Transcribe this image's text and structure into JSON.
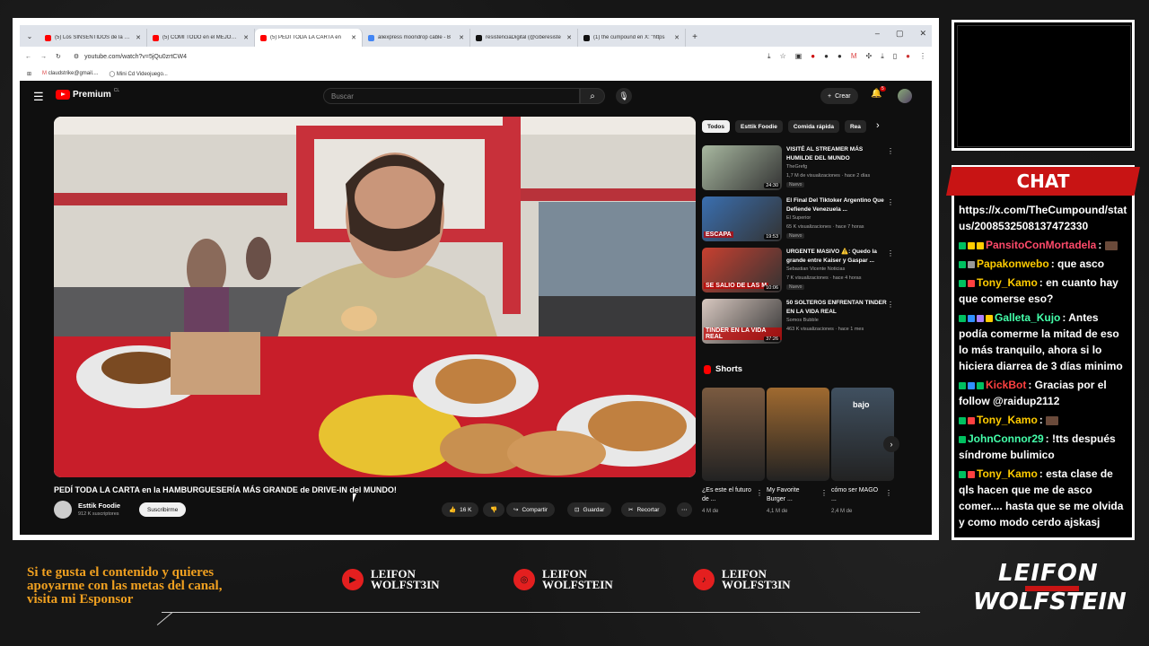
{
  "browser": {
    "tabs": [
      {
        "title": "(5) Los SINSENTIDOS de la saga",
        "favicon_color": "#ff0000"
      },
      {
        "title": "(5) COMÍ TODO en el MEJOR SI",
        "favicon_color": "#ff0000"
      },
      {
        "title": "(5) PEDÍ TODA LA CARTA en",
        "favicon_color": "#ff0000",
        "active": true
      },
      {
        "title": "aliexpress moondrop cable - B",
        "favicon_color": "#4285f4"
      },
      {
        "title": "resistenciaDigital (@ciberesiste",
        "favicon_color": "#111111"
      },
      {
        "title": "(1) the cumpound en X: \"https",
        "favicon_color": "#111111"
      }
    ],
    "new_tab": "+",
    "window_controls": {
      "minimize": "–",
      "maximize": "▢",
      "close": "✕"
    },
    "url": "youtube.com/watch?v=5jQu0zrtCW4",
    "bookmarks": [
      {
        "label": "claudstrike@gmail...."
      },
      {
        "label": "Mini Cd Videojuego..."
      }
    ]
  },
  "youtube": {
    "logo_text": "Premium",
    "logo_country": "CL",
    "search_placeholder": "Buscar",
    "create_label": "Crear",
    "notification_count": "5",
    "video": {
      "title": "PEDÍ TODA LA CARTA en la HAMBURGUESERÍA MÁS GRANDE de DRIVE-IN del MUNDO!",
      "channel": "Esttik Foodie",
      "subscribers": "912 K suscriptores",
      "subscribe_label": "Suscribirme",
      "likes": "16 K",
      "share_label": "Compartir",
      "save_label": "Guardar",
      "clip_label": "Recortar"
    },
    "chips": [
      "Todos",
      "Esttik Foodie",
      "Comida rápida",
      "Rea"
    ],
    "recommendations": [
      {
        "title": "VISITÉ AL STREAMER MÁS HUMILDE DEL MUNDO",
        "channel": "TheGrefg",
        "views": "1,7 M de visualizaciones · hace 2 días",
        "badge": "Nuevo",
        "duration": "24:30",
        "thumb_color": "#a8b8a0"
      },
      {
        "title": "El Final Del Tiktoker Argentino Que Defiende Venezuela ...",
        "channel": "El Superior",
        "views": "65 K visualizaciones · hace 7 horas",
        "badge": "Nuevo",
        "duration": "19:53",
        "thumb_color": "#3a6fb0",
        "thumb_text": "ESCAPA"
      },
      {
        "title": "URGENTE MASIVO ⚠️: Quedo la grande entre Kaiser y Gaspar ...",
        "channel": "Sebastian Vicente Noticias",
        "views": "7 K visualizaciones · hace 4 horas",
        "badge": "Nuevo",
        "duration": "10:06",
        "thumb_color": "#c84030",
        "thumb_text": "SE SALIO DE LAS M"
      },
      {
        "title": "50 SOLTEROS ENFRENTAN TINDER EN LA VIDA REAL",
        "channel": "Somos Bubble",
        "views": "463 K visualizaciones · hace 1 mes",
        "badge": "",
        "duration": "37:26",
        "thumb_color": "#d8c8c0",
        "thumb_text": "TINDER EN LA VIDA REAL"
      }
    ],
    "shorts_heading": "Shorts",
    "shorts": [
      {
        "title": "¿Es este el futuro de ...",
        "views": "4 M de",
        "thumb_color": "#7a5a40"
      },
      {
        "title": "My Favorite Burger ...",
        "views": "4,1 M de",
        "thumb_color": "#a06a30"
      },
      {
        "title": "cómo ser MAGO ...",
        "views": "2,4 M de",
        "thumb_color": "#405060",
        "thumb_text": "bajo"
      }
    ]
  },
  "overlay": {
    "chat_title": "CHAT",
    "chat_messages": [
      {
        "user": "",
        "text": "https://x.com/TheCumpound/status/2008532508137472330",
        "user_color": "#ffffff"
      },
      {
        "user": "PansitoConMortadela",
        "text": ":",
        "user_color": "#ff4a6a",
        "badges": [
          "#00c060",
          "#ffcc00",
          "#ffcc00"
        ],
        "emote_after": true
      },
      {
        "user": "Papakonwebo",
        "text": ": que asco",
        "user_color": "#ffcc00",
        "badges": [
          "#00c060",
          "#999999"
        ]
      },
      {
        "user": "Tony_Kamo",
        "text": ": en cuanto hay que comerse eso?",
        "user_color": "#ffcc00",
        "badges": [
          "#00c060",
          "#ff4040"
        ]
      },
      {
        "user": "Galleta_Kujo",
        "text": ": Antes podía comerme la mitad de eso lo más tranquilo, ahora si lo hiciera diarrea de 3 días minimo",
        "user_color": "#44ffaa",
        "badges": [
          "#00c060",
          "#3090ff",
          "#aa80ff",
          "#ffcc00"
        ]
      },
      {
        "user": "KickBot",
        "text": ": Gracias por el follow @raidup2112",
        "user_color": "#ff4040",
        "badges": [
          "#00c060",
          "#3090ff",
          "#00c060"
        ]
      },
      {
        "user": "Tony_Kamo",
        "text": ":",
        "user_color": "#ffcc00",
        "badges": [
          "#00c060",
          "#ff4040"
        ],
        "emote_after": true
      },
      {
        "user": "JohnConnor29",
        "text": ": !tts después síndrome bulimico",
        "user_color": "#44ffaa",
        "badges": [
          "#00c060"
        ]
      },
      {
        "user": "Tony_Kamo",
        "text": ": esta clase de qls hacen que me de asco comer.... hasta que se me olvida y como modo cerdo ajskasj",
        "user_color": "#ffcc00",
        "badges": [
          "#00c060",
          "#ff4040"
        ]
      }
    ],
    "sponsor_text": [
      "Si te gusta el contenido y quieres",
      "apoyarme con las metas del canal,",
      "visita mi Esponsor"
    ],
    "socials": [
      {
        "platform": "youtube-icon",
        "line1": "LEIFON",
        "line2": "WOLFST3IN",
        "glyph": "▶"
      },
      {
        "platform": "instagram-icon",
        "line1": "LEIFON",
        "line2": "WOLFSTEIN",
        "glyph": "◎"
      },
      {
        "platform": "tiktok-icon",
        "line1": "LEIFON",
        "line2": "WOLFST3IN",
        "glyph": "♪"
      }
    ],
    "brand_line1": "LEIFON",
    "brand_line2": "WOLFSTEIN"
  }
}
